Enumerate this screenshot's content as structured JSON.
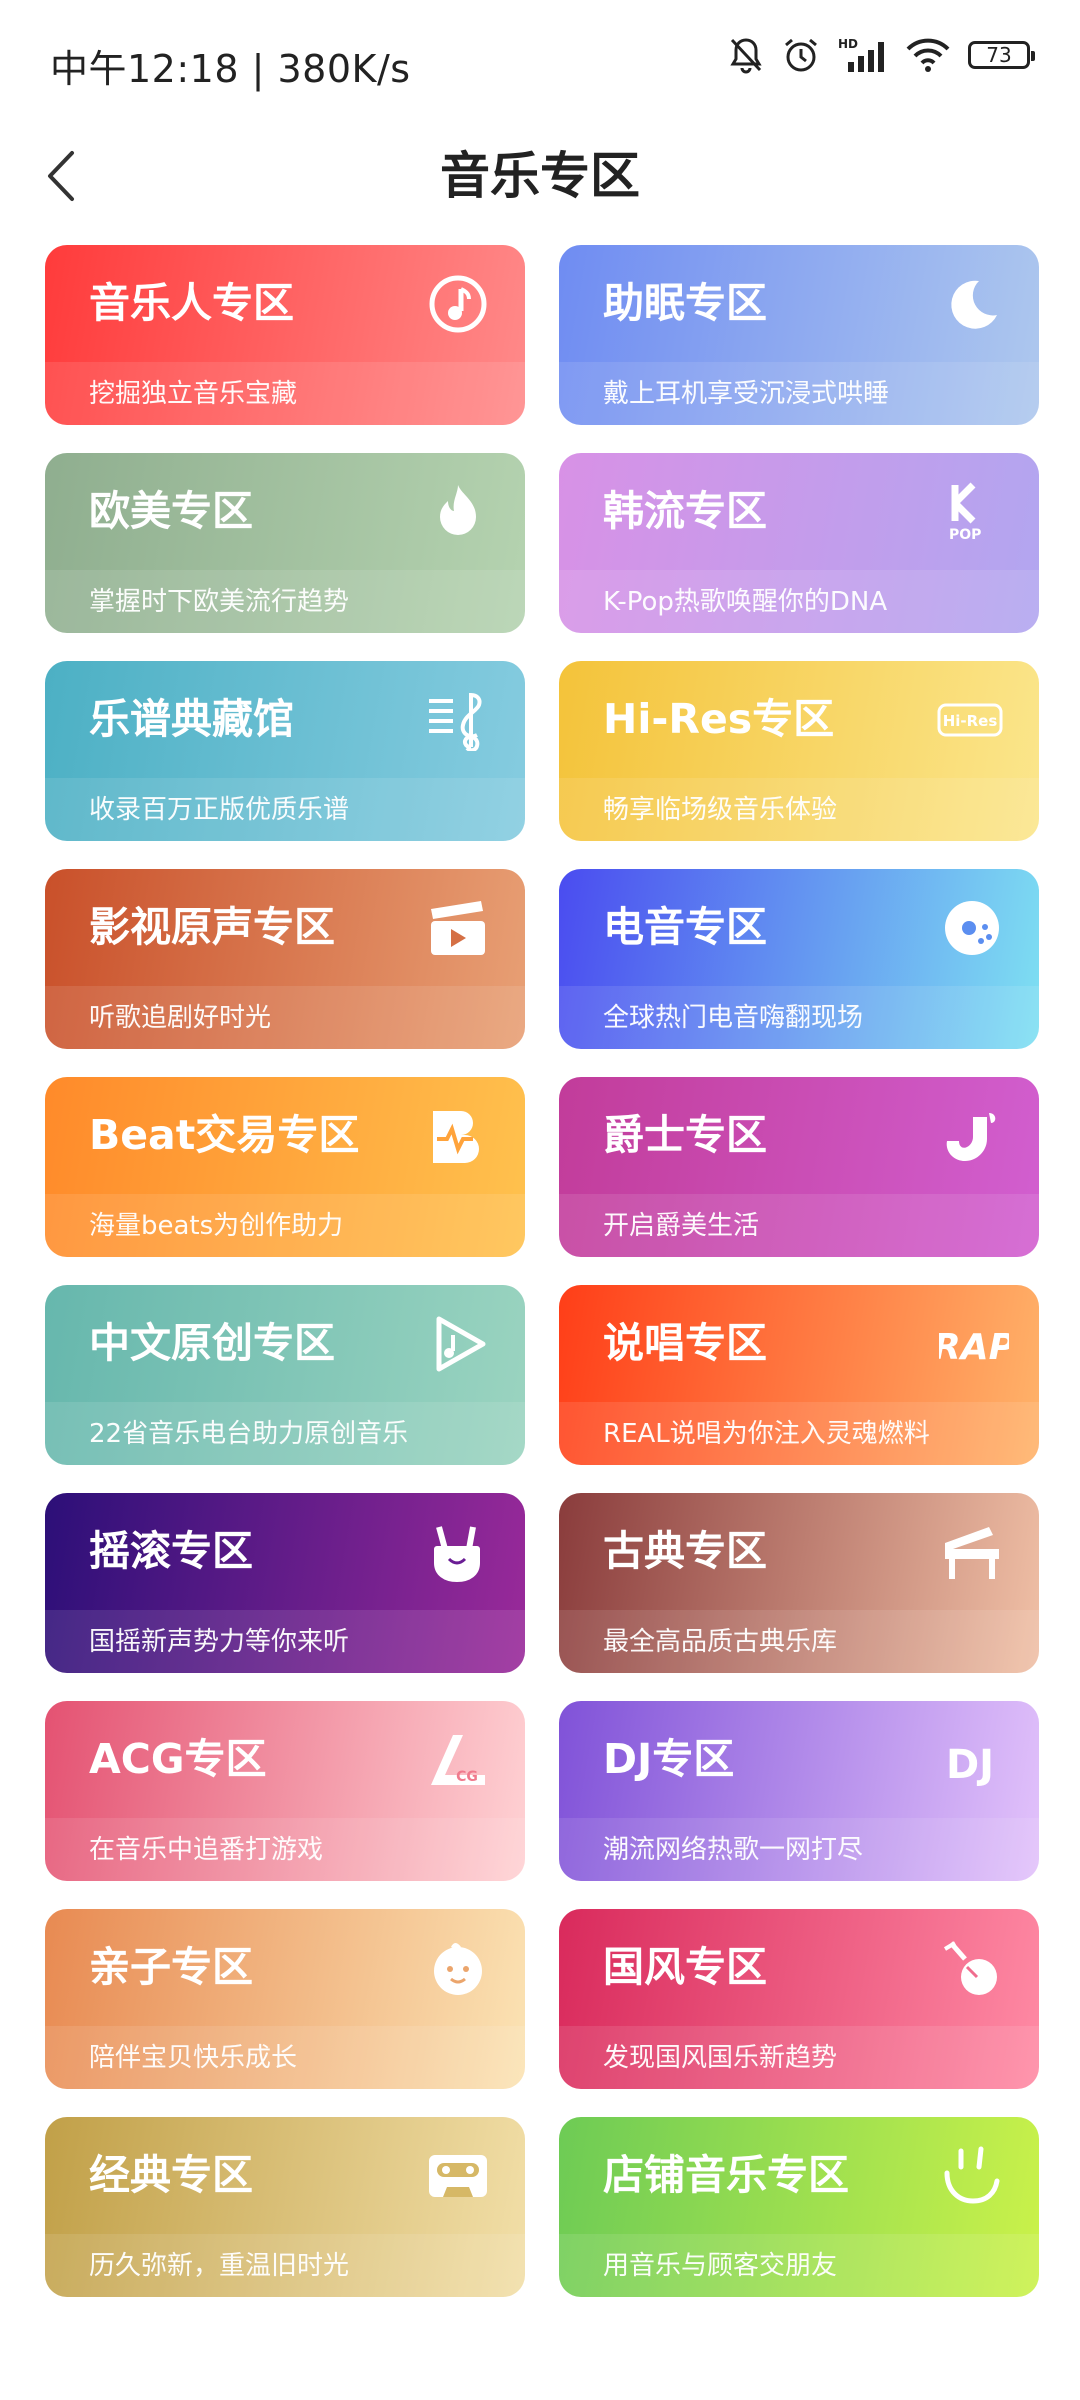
{
  "status": {
    "time": "中午12:18",
    "speed": "380K/s",
    "network_label": "HD",
    "battery": "73"
  },
  "header": {
    "title": "音乐专区"
  },
  "cards": [
    {
      "title": "音乐人专区",
      "subtitle": "挖掘独立音乐宝藏",
      "icon": "music-note-icon",
      "from": "#ff3b3b",
      "to": "#ff8a8a"
    },
    {
      "title": "助眠专区",
      "subtitle": "戴上耳机享受沉浸式哄睡",
      "icon": "moon-icon",
      "from": "#6f8cf2",
      "to": "#aec8ee"
    },
    {
      "title": "欧美专区",
      "subtitle": "掌握时下欧美流行趋势",
      "icon": "flame-icon",
      "from": "#8fae8f",
      "to": "#b5d3b0"
    },
    {
      "title": "韩流专区",
      "subtitle": "K-Pop热歌唤醒你的DNA",
      "icon": "kpop-icon",
      "from": "#d891e6",
      "to": "#b2a6f0"
    },
    {
      "title": "乐谱典藏馆",
      "subtitle": "收录百万正版优质乐谱",
      "icon": "sheet-music-icon",
      "from": "#4cb0c4",
      "to": "#86cce0"
    },
    {
      "title": "Hi-Res专区",
      "subtitle": "畅享临场级音乐体验",
      "icon": "hi-res-icon",
      "from": "#f4c33a",
      "to": "#fbe68c"
    },
    {
      "title": "影视原声专区",
      "subtitle": "听歌追剧好时光",
      "icon": "clapperboard-icon",
      "from": "#c9502a",
      "to": "#e8a075"
    },
    {
      "title": "电音专区",
      "subtitle": "全球热门电音嗨翻现场",
      "icon": "disc-icon",
      "from": "#4a4cf0",
      "to": "#7ee0f2"
    },
    {
      "title": "Beat交易专区",
      "subtitle": "海量beats为创作助力",
      "icon": "beat-icon",
      "from": "#ff8a2a",
      "to": "#ffc24e"
    },
    {
      "title": "爵士专区",
      "subtitle": "开启爵美生活",
      "icon": "saxophone-icon",
      "from": "#c23c9a",
      "to": "#d25fd0"
    },
    {
      "title": "中文原创专区",
      "subtitle": "22省音乐电台助力原创音乐",
      "icon": "play-triangle-icon",
      "from": "#66b7ad",
      "to": "#9bd4c0"
    },
    {
      "title": "说唱专区",
      "subtitle": "REAL说唱为你注入灵魂燃料",
      "icon": "rap-icon",
      "from": "#ff3e18",
      "to": "#ffb36a"
    },
    {
      "title": "摇滚专区",
      "subtitle": "国摇新声势力等你来听",
      "icon": "rock-hand-icon",
      "from": "#2c0f78",
      "to": "#9a2a9a"
    },
    {
      "title": "古典专区",
      "subtitle": "最全高品质古典乐库",
      "icon": "piano-icon",
      "from": "#8a3c3c",
      "to": "#f0c0a6"
    },
    {
      "title": "ACG专区",
      "subtitle": "在音乐中追番打游戏",
      "icon": "acg-icon",
      "from": "#e45272",
      "to": "#ffd2d4"
    },
    {
      "title": "DJ专区",
      "subtitle": "潮流网络热歌一网打尽",
      "icon": "dj-icon",
      "from": "#8052d8",
      "to": "#e2c2fb"
    },
    {
      "title": "亲子专区",
      "subtitle": "陪伴宝贝快乐成长",
      "icon": "baby-face-icon",
      "from": "#e88a52",
      "to": "#fbe3b4"
    },
    {
      "title": "国风专区",
      "subtitle": "发现国风国乐新趋势",
      "icon": "pipa-icon",
      "from": "#d92a5c",
      "to": "#ff8aa4"
    },
    {
      "title": "经典专区",
      "subtitle": "历久弥新，重温旧时光",
      "icon": "cassette-icon",
      "from": "#c1a048",
      "to": "#f2dfa8"
    },
    {
      "title": "店铺音乐专区",
      "subtitle": "用音乐与顾客交朋友",
      "icon": "smile-icon",
      "from": "#6dcb55",
      "to": "#cbf24a"
    }
  ]
}
